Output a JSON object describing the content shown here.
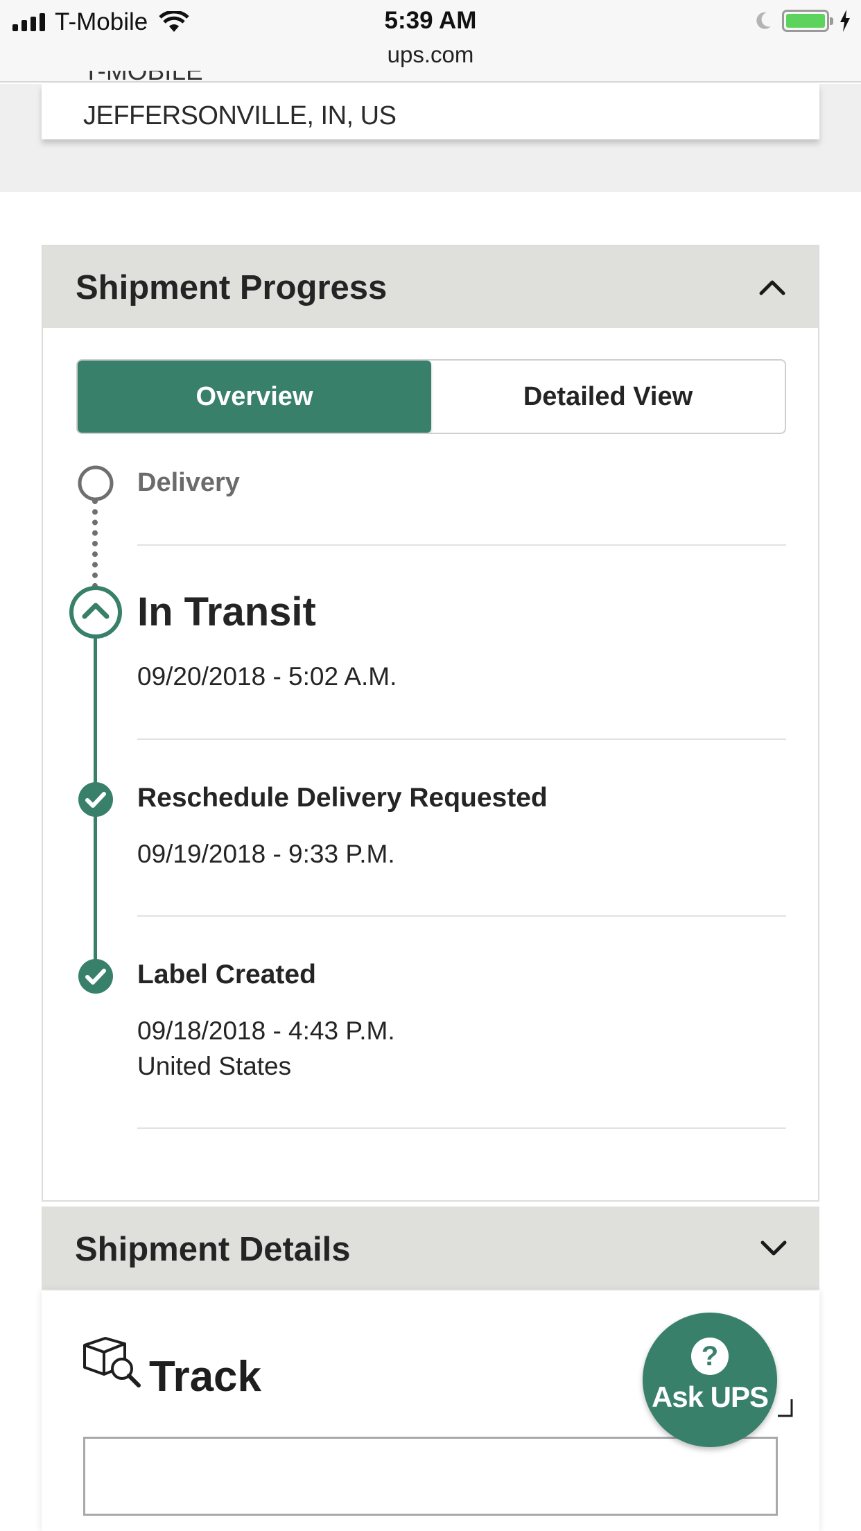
{
  "status_bar": {
    "carrier": "T-Mobile",
    "time": "5:39 AM",
    "url": "ups.com"
  },
  "address": {
    "cut_line": "T-MOBILE",
    "city_line": "JEFFERSONVILLE, IN, US"
  },
  "progress": {
    "title": "Shipment Progress",
    "tabs": {
      "overview": "Overview",
      "detailed": "Detailed View"
    },
    "events": [
      {
        "title": "Delivery",
        "date": "",
        "location": "",
        "state": "pending"
      },
      {
        "title": "In Transit",
        "date": "09/20/2018 - 5:02 A.M.",
        "location": "",
        "state": "current"
      },
      {
        "title": "Reschedule Delivery Requested",
        "date": "09/19/2018 - 9:33 P.M.",
        "location": "",
        "state": "done"
      },
      {
        "title": "Label Created",
        "date": "09/18/2018 - 4:43 P.M.",
        "location": "United States",
        "state": "done"
      }
    ]
  },
  "details": {
    "title": "Shipment Details"
  },
  "track": {
    "title": "Track",
    "input_value": ""
  },
  "ask_ups": {
    "label": "Ask UPS",
    "icon_glyph": "?"
  },
  "colors": {
    "ups_green": "#38806a",
    "panel_header": "#dfdfdc",
    "battery_green": "#5cd35c"
  }
}
